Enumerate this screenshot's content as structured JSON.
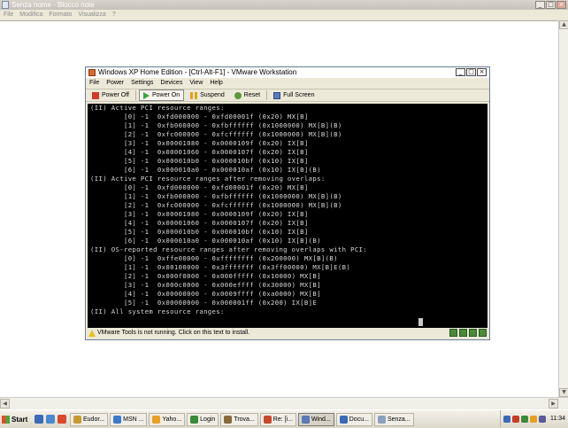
{
  "notepad": {
    "title": "Senza nome - Blocco note",
    "menu": [
      "File",
      "Modifica",
      "Formato",
      "Visualizza",
      "?"
    ]
  },
  "vmware": {
    "title": "Windows XP Home Edition - [Ctrl-Alt-F1] - VMware Workstation",
    "menu": [
      "File",
      "Power",
      "Settings",
      "Devices",
      "View",
      "Help"
    ],
    "toolbar": {
      "power_off": "Power Off",
      "power_on": "Power On",
      "suspend": "Suspend",
      "reset": "Reset",
      "full_screen": "Full Screen"
    },
    "console_lines": [
      "(II) Active PCI resource ranges:",
      "        [0] -1  0xfd000000 - 0xfd00001f (0x20) MX[B]",
      "        [1] -1  0xfb000000 - 0xfbffffff (0x1000000) MX[B](B)",
      "        [2] -1  0xfc000000 - 0xfcffffff (0x1000000) MX[B](B)",
      "        [3] -1  0x00001080 - 0x0000109f (0x20) IX[B]",
      "        [4] -1  0x00001060 - 0x0000107f (0x20) IX[B]",
      "        [5] -1  0x000010b0 - 0x000010bf (0x10) IX[B]",
      "        [6] -1  0x000010a0 - 0x000010af (0x10) IX[B](B)",
      "(II) Active PCI resource ranges after removing overlaps:",
      "        [0] -1  0xfd000000 - 0xfd00001f (0x20) MX[B]",
      "        [1] -1  0xfb000000 - 0xfbffffff (0x1000000) MX[B](B)",
      "        [2] -1  0xfc000000 - 0xfcffffff (0x1000000) MX[B](B)",
      "        [3] -1  0x00001080 - 0x0000109f (0x20) IX[B]",
      "        [4] -1  0x00001060 - 0x0000107f (0x20) IX[B]",
      "        [5] -1  0x000010b0 - 0x000010bf (0x10) IX[B]",
      "        [6] -1  0x000010a0 - 0x000010af (0x10) IX[B](B)",
      "(II) OS-reported resource ranges after removing overlaps with PCI:",
      "        [0] -1  0xffe00000 - 0xffffffff (0x200000) MX[B](B)",
      "        [1] -1  0x00100000 - 0x3fffffff (0x3ff00000) MX[B]E(B)",
      "        [2] -1  0x000f0000 - 0x000fffff (0x10000) MX[B]",
      "        [3] -1  0x000c0000 - 0x000effff (0x30000) MX[B]",
      "        [4] -1  0x00000000 - 0x0009ffff (0xa0000) MX[B]",
      "        [5] -1  0x00000000 - 0x000001ff (0x200) IX[B]E",
      "(II) All system resource ranges:"
    ],
    "status_message": "VMware Tools is not running. Click on this text to install."
  },
  "taskbar": {
    "start_label": "Start",
    "tasks": [
      {
        "label": "Eudor...",
        "color": "#c89a30"
      },
      {
        "label": "MSN ...",
        "color": "#3a7ad0"
      },
      {
        "label": "Yaho...",
        "color": "#e8a020"
      },
      {
        "label": "Login",
        "color": "#3a8a3a"
      },
      {
        "label": "Trova...",
        "color": "#8a6a3a"
      },
      {
        "label": "Re: [i...",
        "color": "#c84a2a"
      },
      {
        "label": "Wind...",
        "color": "#5a7ab8"
      },
      {
        "label": "Docu...",
        "color": "#3a6ab8"
      },
      {
        "label": "Senza...",
        "color": "#8aa0c0"
      }
    ],
    "clock": "11:34"
  }
}
